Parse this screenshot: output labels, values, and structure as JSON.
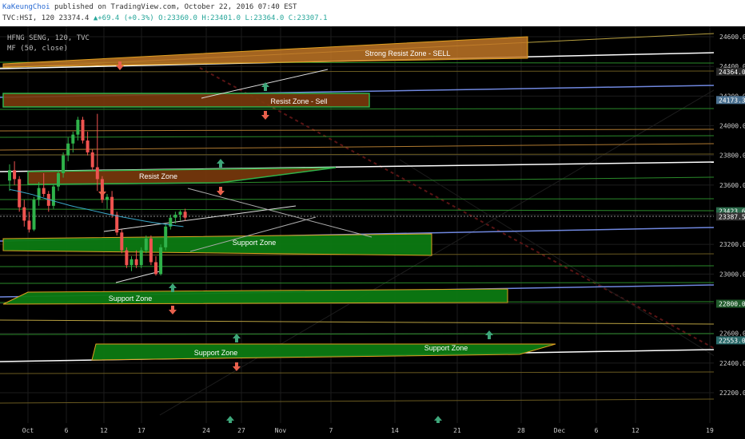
{
  "header": {
    "author": "KaKeungChoi",
    "published_text": "published on TradingView.com, October 22, 2016 07:40 EST",
    "symbol": "TVC:HSI, 120",
    "last": "23374.4",
    "change": "+69.4 (+0.3%)",
    "open": "O:23360.0",
    "high": "H:23401.0",
    "low": "L:23364.0",
    "close": "C:23307.1"
  },
  "legend": {
    "line1": "HFNG SENG, 120, TVC",
    "line2": "MF (50, close)"
  },
  "colors": {
    "background": "#000000",
    "grid": "#1c1c1c",
    "candle_up": "#2fb24a",
    "candle_down": "#ef5350",
    "zone_green": "#0c7a12",
    "zone_orange": "#7a3a0c",
    "zone_orange_light": "#c07526",
    "zone_border": "#e0a020",
    "arrow_up": "#3ea67a",
    "arrow_down": "#e8604c",
    "ma": "#3aa8c9"
  },
  "chart_data": {
    "type": "candlestick",
    "title": "HFNG SENG, 120, TVC",
    "indicator": "MF (50, close)",
    "ylim": [
      22120,
      24640
    ],
    "y_ticks": [
      "24600.0",
      "24400.0",
      "24200.0",
      "24000.0",
      "23800.0",
      "23600.0",
      "23400.0",
      "23200.0",
      "23000.0",
      "22800.0",
      "22600.0",
      "22400.0",
      "22200.0"
    ],
    "x_ticks": [
      "Oct",
      "6",
      "12",
      "17",
      "24",
      "27",
      "Nov",
      "7",
      "14",
      "21",
      "28",
      "Dec",
      "6",
      "12",
      "19"
    ],
    "price_labels": [
      "24364.0",
      "24173.3",
      "23423.6",
      "23387.5",
      "22800.0",
      "22553.0"
    ],
    "zone_labels": [
      "Strong Resist Zone - SELL",
      "Resist Zone - Sell",
      "Resist Zone",
      "Support Zone",
      "Support Zone",
      "Support Zone",
      "Support Zone"
    ],
    "series": [
      {
        "values": [
          [
            23630,
            23740,
            23560,
            23700
          ],
          [
            23700,
            23760,
            23600,
            23640
          ],
          [
            23640,
            23660,
            23420,
            23450
          ],
          [
            23450,
            23500,
            23320,
            23360
          ],
          [
            23360,
            23420,
            23280,
            23300
          ],
          [
            23300,
            23520,
            23290,
            23500
          ],
          [
            23500,
            23620,
            23460,
            23580
          ],
          [
            23580,
            23680,
            23520,
            23540
          ],
          [
            23540,
            23560,
            23420,
            23460
          ],
          [
            23460,
            23600,
            23440,
            23590
          ],
          [
            23590,
            23700,
            23560,
            23680
          ],
          [
            23680,
            23820,
            23650,
            23800
          ],
          [
            23800,
            23920,
            23760,
            23880
          ],
          [
            23880,
            23960,
            23820,
            23940
          ],
          [
            23940,
            24060,
            23900,
            24040
          ],
          [
            24040,
            24060,
            23880,
            23900
          ],
          [
            23900,
            23960,
            23800,
            23820
          ],
          [
            23820,
            23840,
            23700,
            23720
          ],
          [
            23720,
            24080,
            23560,
            23640
          ],
          [
            23640,
            23660,
            23480,
            23500
          ],
          [
            23500,
            23540,
            23440,
            23520
          ],
          [
            23520,
            23560,
            23380,
            23400
          ],
          [
            23400,
            23420,
            23260,
            23280
          ],
          [
            23280,
            23300,
            23140,
            23160
          ],
          [
            23160,
            23180,
            23040,
            23060
          ],
          [
            23060,
            23120,
            23020,
            23100
          ],
          [
            23100,
            23160,
            23040,
            23060
          ],
          [
            23060,
            23180,
            23040,
            23160
          ],
          [
            23160,
            23260,
            23140,
            23240
          ],
          [
            23240,
            23260,
            23060,
            23080
          ],
          [
            23080,
            23120,
            22990,
            23000
          ],
          [
            23000,
            23200,
            22990,
            23180
          ],
          [
            23180,
            23340,
            23160,
            23320
          ],
          [
            23320,
            23400,
            23300,
            23380
          ],
          [
            23380,
            23420,
            23340,
            23400
          ],
          [
            23400,
            23430,
            23360,
            23420
          ],
          [
            23420,
            23440,
            23360,
            23380
          ]
        ]
      },
      {
        "name": "MF (50, close)",
        "values": [
          23570,
          23560,
          23548,
          23536,
          23520,
          23505,
          23490,
          23476,
          23462,
          23450,
          23440,
          23428,
          23416,
          23405,
          23394,
          23384,
          23374,
          23365,
          23356,
          23348,
          23340,
          23333,
          23326,
          23320
        ]
      }
    ]
  }
}
